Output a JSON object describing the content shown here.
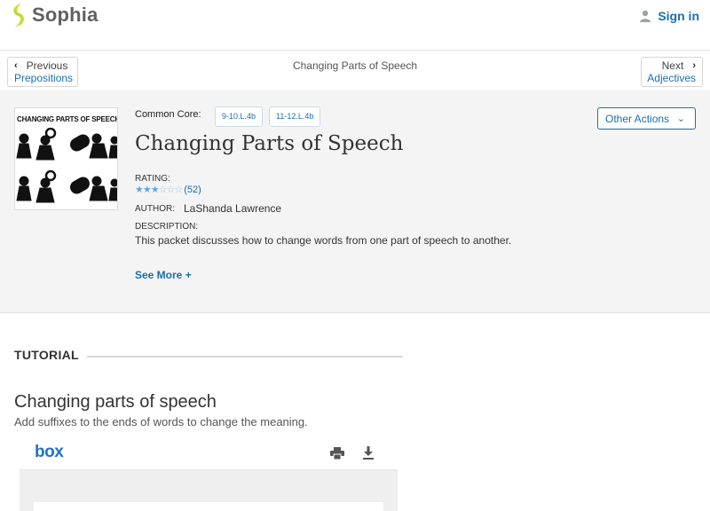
{
  "header": {
    "logo_text": "Sophia",
    "signin_label": "Sign in",
    "brand_color": "#c6d92e",
    "link_color": "#1a6fae"
  },
  "nav": {
    "prev_dir": "Previous",
    "prev_target": "Prepositions",
    "current_title": "Changing Parts of Speech",
    "next_dir": "Next",
    "next_target": "Adjectives"
  },
  "hero": {
    "thumbnail_caption": "CHANGING PARTS OF SPEECH",
    "common_core_label": "Common Core:",
    "common_core_tags": [
      "9-10.L.4b",
      "11-12.L.4b"
    ],
    "title": "Changing Parts of Speech",
    "other_actions_label": "Other Actions",
    "rating_label": "RATING:",
    "rating_stars": 3,
    "rating_max": 6,
    "rating_count": "(52)",
    "author_label": "AUTHOR:",
    "author_name": "LaShanda Lawrence",
    "description_label": "DESCRIPTION:",
    "description": "This packet discusses how to change words from one part of speech to another.",
    "see_more_label": "See More +"
  },
  "tutorial": {
    "section_label": "TUTORIAL",
    "title": "Changing parts of speech",
    "subtitle": "Add suffixes to the ends of words to change the meaning."
  },
  "viewer": {
    "logo_text": "box",
    "icons": [
      "print-icon",
      "download-icon"
    ]
  }
}
